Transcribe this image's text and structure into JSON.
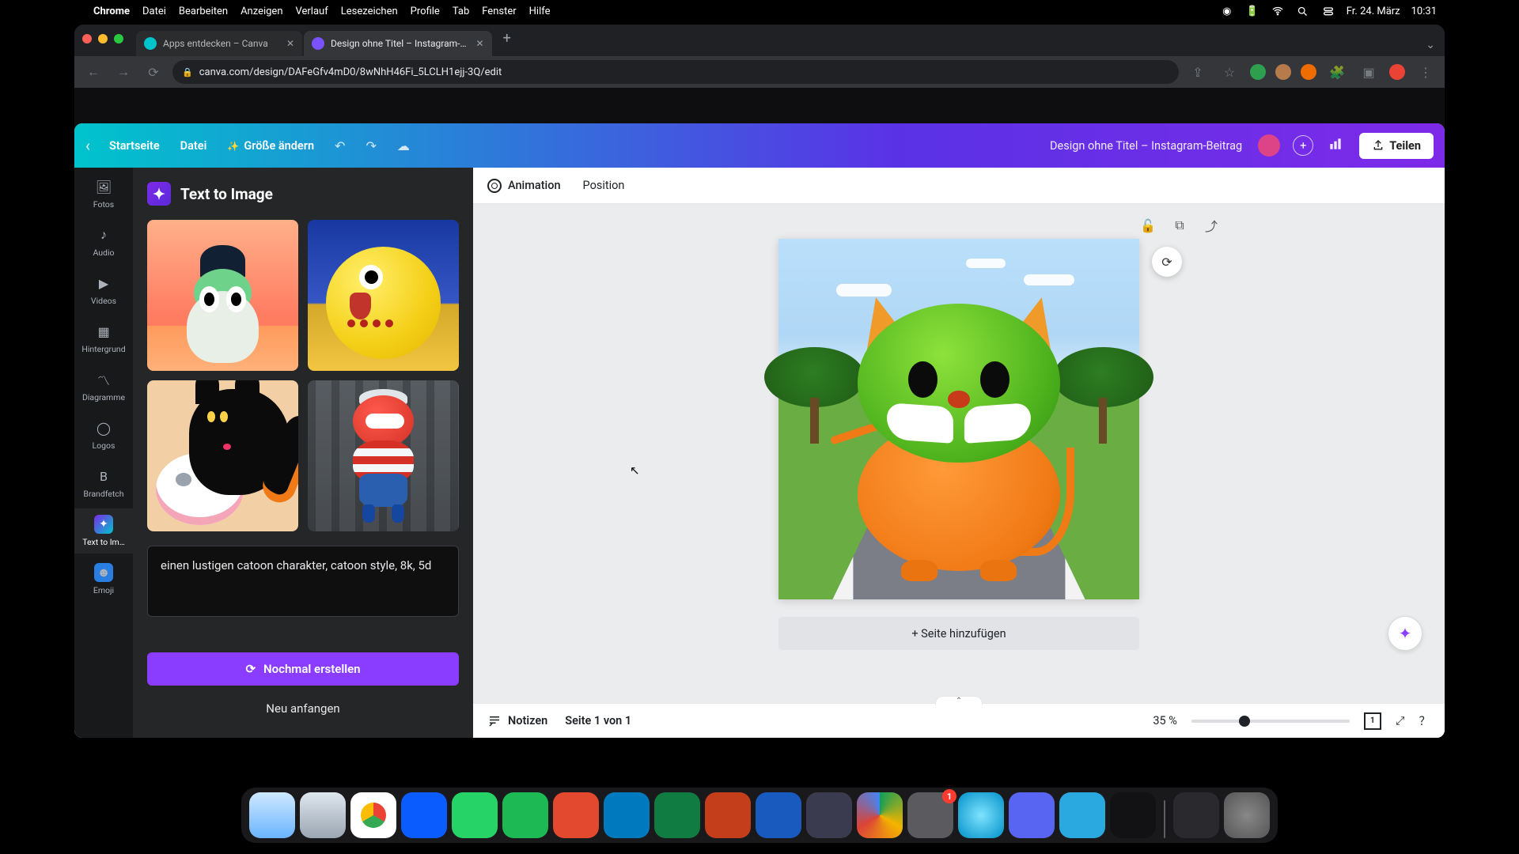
{
  "mac_menu": {
    "app": "Chrome",
    "items": [
      "Datei",
      "Bearbeiten",
      "Anzeigen",
      "Verlauf",
      "Lesezeichen",
      "Profile",
      "Tab",
      "Fenster",
      "Hilfe"
    ],
    "date": "Fr. 24. März",
    "time": "10:31"
  },
  "browser": {
    "tabs": [
      {
        "title": "Apps entdecken – Canva",
        "active": false
      },
      {
        "title": "Design ohne Titel – Instagram-…",
        "active": true
      }
    ],
    "url": "canva.com/design/DAFeGfv4mD0/8wNhH46Fi_5LCLH1ejj-3Q/edit"
  },
  "canva_header": {
    "home": "Startseite",
    "file": "Datei",
    "resize": "Größe ändern",
    "title": "Design ohne Titel – Instagram-Beitrag",
    "share": "Teilen"
  },
  "rail": {
    "fotos": "Fotos",
    "audio": "Audio",
    "videos": "Videos",
    "hintergrund": "Hintergrund",
    "diagramme": "Diagramme",
    "logos": "Logos",
    "brandfetch": "Brandfetch",
    "text_to_image": "Text to Im…",
    "emoji": "Emoji"
  },
  "panel": {
    "title": "Text to Image",
    "prompt": "einen lustigen catoon charakter, catoon style, 8k, 5d",
    "regenerate": "Nochmal erstellen",
    "start_over": "Neu anfangen"
  },
  "context_bar": {
    "animation": "Animation",
    "position": "Position"
  },
  "add_page": "+ Seite hinzufügen",
  "bottom_bar": {
    "notes": "Notizen",
    "page_indicator": "Seite 1 von 1",
    "zoom": "35 %",
    "zoom_pos_pct": 30,
    "grid_count": "1"
  },
  "dock": {
    "badge_count": "1"
  }
}
